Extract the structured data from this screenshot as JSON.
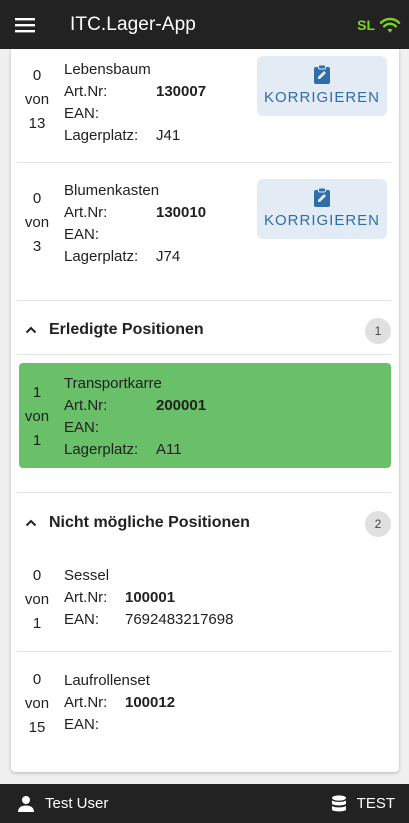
{
  "app": {
    "title": "ITC.Lager-App",
    "status": "SL"
  },
  "open_items": [
    {
      "done": "0",
      "von": "von",
      "total": "13",
      "name": "Lebensbaum",
      "artnr_label": "Art.Nr:",
      "artnr": "130007",
      "ean_label": "EAN:",
      "ean": "",
      "lager_label": "Lagerplatz:",
      "lager": "J41",
      "button": "KORRIGIEREN"
    },
    {
      "done": "0",
      "von": "von",
      "total": "3",
      "name": "Blumenkasten",
      "artnr_label": "Art.Nr:",
      "artnr": "130010",
      "ean_label": "EAN:",
      "ean": "",
      "lager_label": "Lagerplatz:",
      "lager": "J74",
      "button": "KORRIGIEREN"
    }
  ],
  "done_section": {
    "title": "Erledigte Positionen",
    "count": "1",
    "items": [
      {
        "done": "1",
        "von": "von",
        "total": "1",
        "name": "Transportkarre",
        "artnr_label": "Art.Nr:",
        "artnr": "200001",
        "ean_label": "EAN:",
        "ean": "",
        "lager_label": "Lagerplatz:",
        "lager": "A11"
      }
    ]
  },
  "impossible_section": {
    "title": "Nicht mögliche Positionen",
    "count": "2",
    "items": [
      {
        "done": "0",
        "von": "von",
        "total": "1",
        "name": "Sessel",
        "artnr_label": "Art.Nr:",
        "artnr": "100001",
        "ean_label": "EAN:",
        "ean": "7692483217698"
      },
      {
        "done": "0",
        "von": "von",
        "total": "15",
        "name": "Laufrollenset",
        "artnr_label": "Art.Nr:",
        "artnr": "100012",
        "ean_label": "EAN:",
        "ean": ""
      }
    ]
  },
  "footer": {
    "user": "Test User",
    "env": "TEST"
  },
  "colors": {
    "appbar": "#222222",
    "status_green": "#7ed321",
    "done_green": "#6abf69",
    "button_bg": "#e3ebf5",
    "button_text": "#2f6ea8"
  },
  "icons": {
    "menu": "hamburger-menu-icon",
    "wifi": "wifi-icon",
    "clipboard": "clipboard-edit-icon",
    "chevron": "chevron-up-icon",
    "user": "person-icon",
    "database": "database-icon"
  }
}
